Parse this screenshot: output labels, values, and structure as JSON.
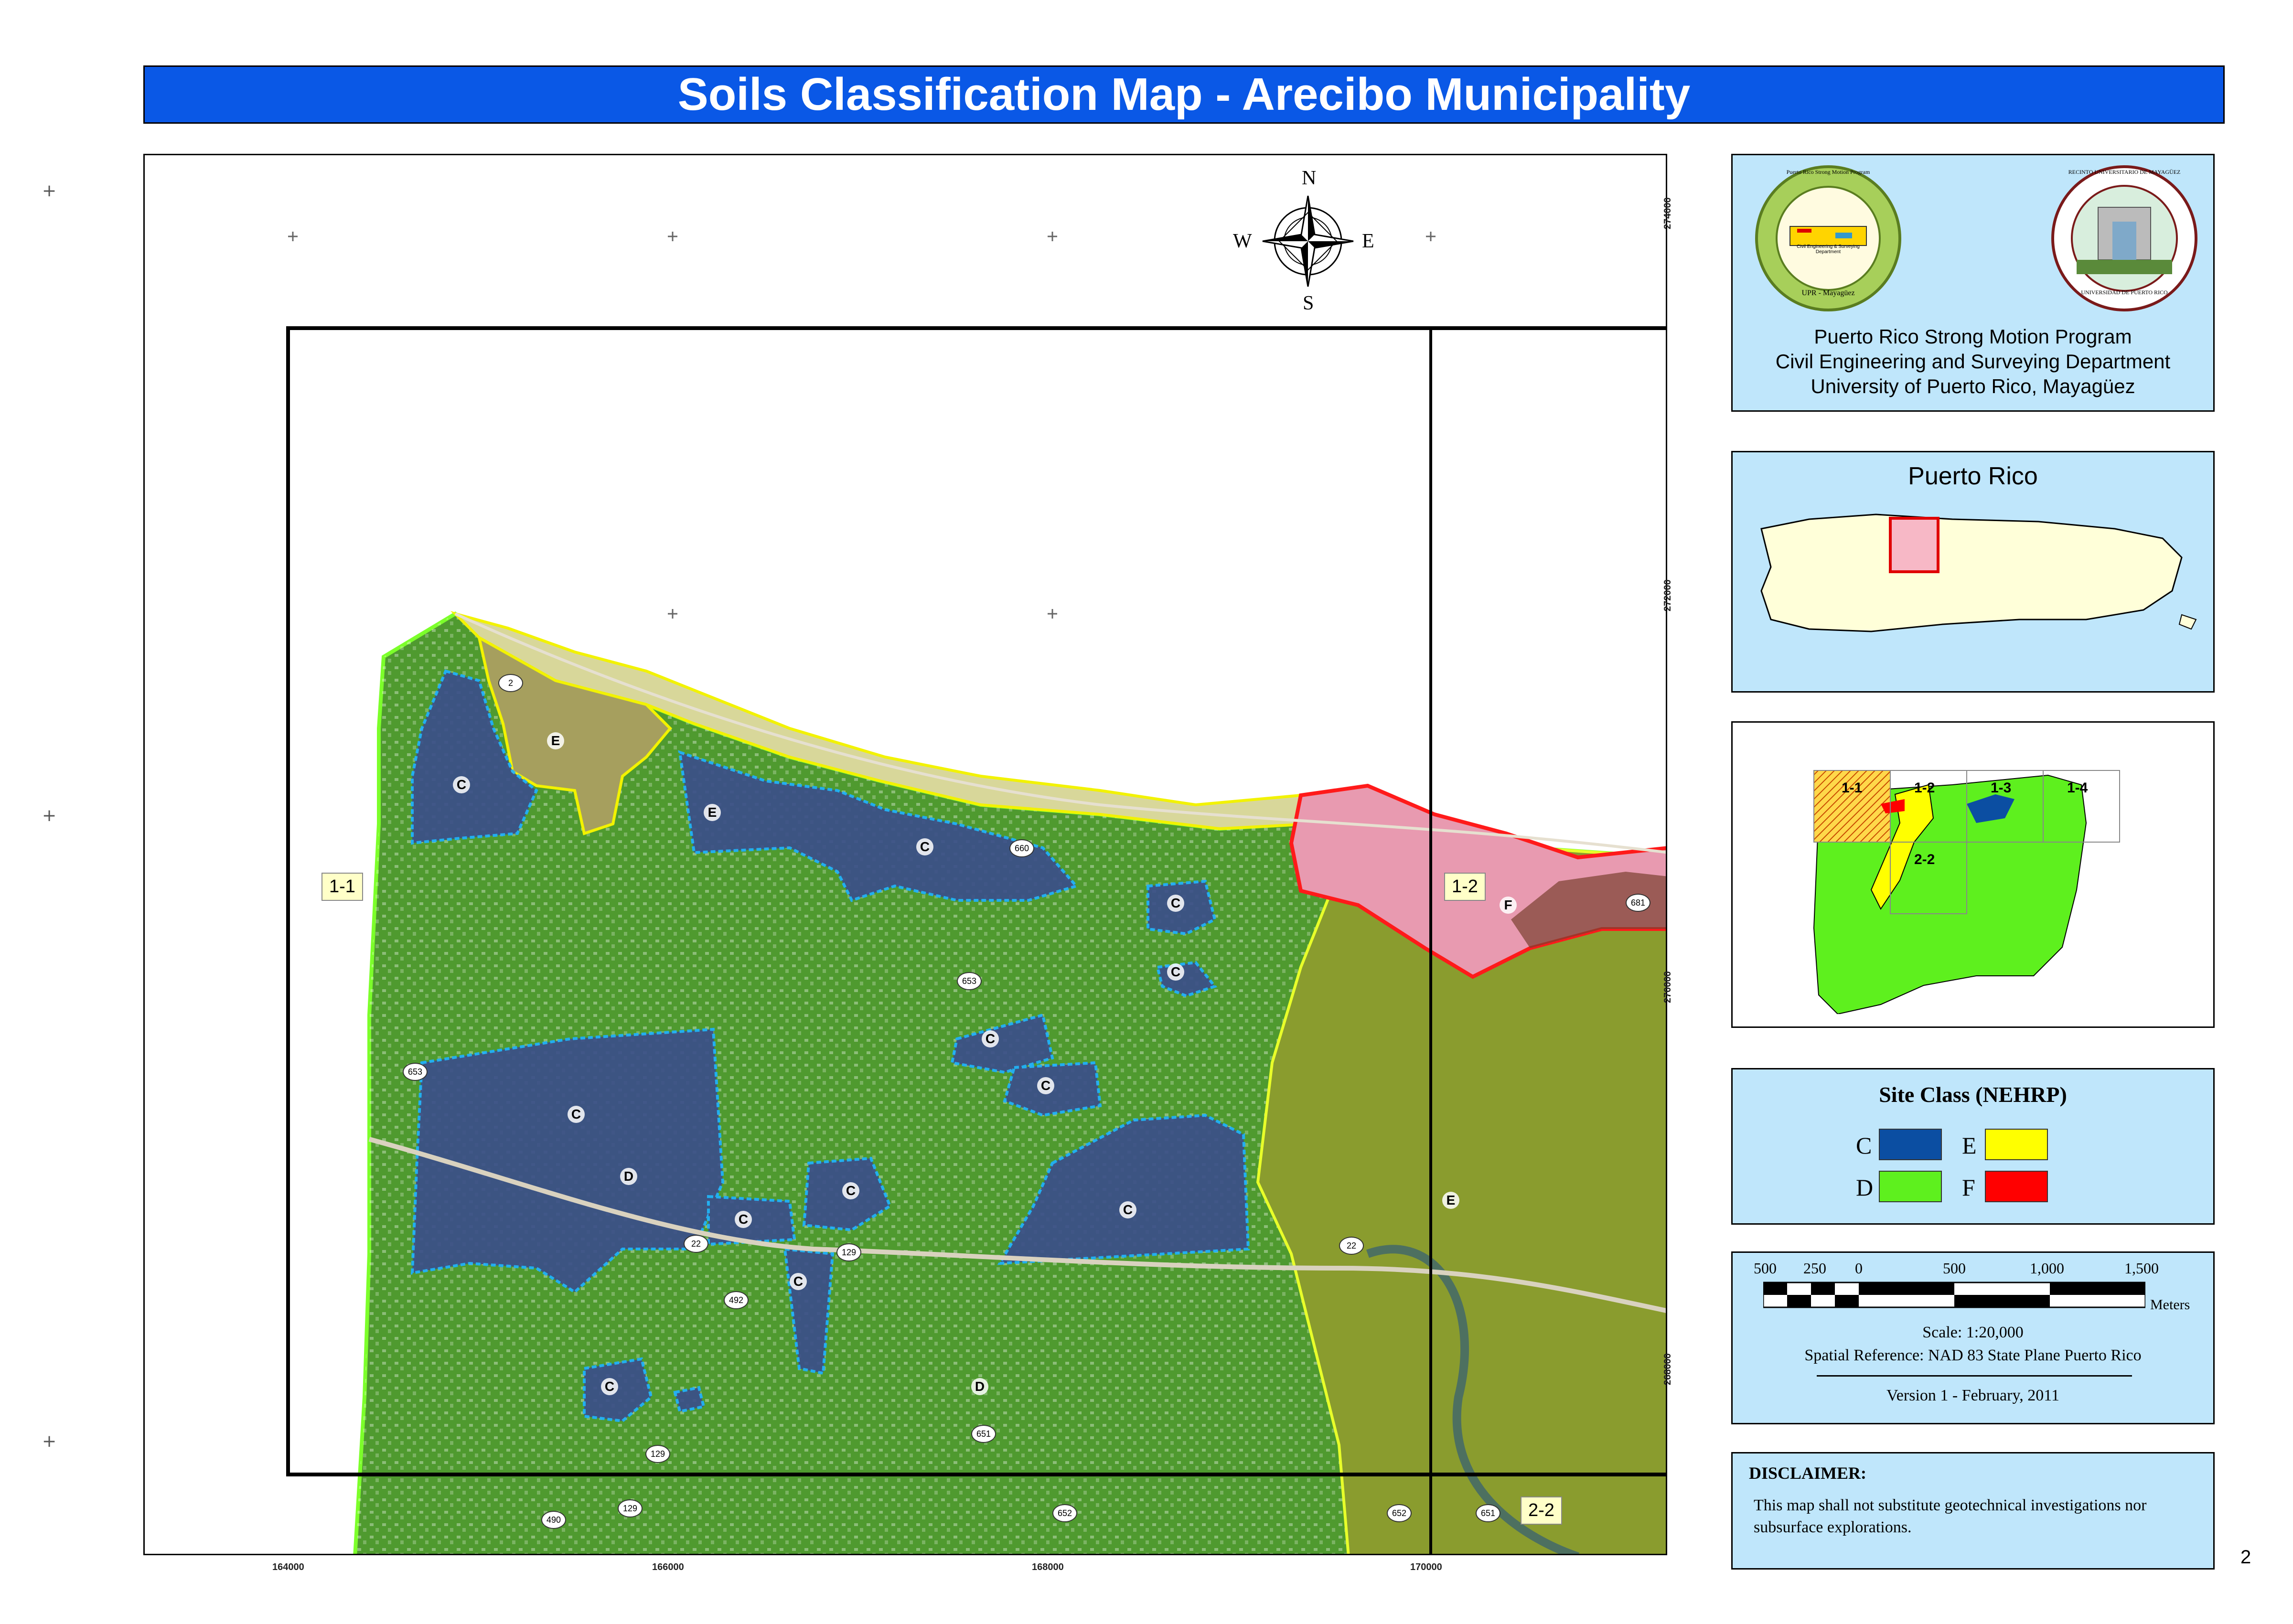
{
  "title": "Soils Classification Map - Arecibo Municipality",
  "page_number": "2",
  "compass": {
    "n": "N",
    "s": "S",
    "e": "E",
    "w": "W"
  },
  "map_sheets": {
    "s11": "1-1",
    "s12": "1-2",
    "s22": "2-2"
  },
  "zone_labels": {
    "c1": "C",
    "c2": "C",
    "c3": "C",
    "c4": "C",
    "c5": "C",
    "c6": "C",
    "c7": "C",
    "c8": "C",
    "c9": "C",
    "c10": "C",
    "c11": "C",
    "c12": "C",
    "c13": "C",
    "d1": "D",
    "d2": "D",
    "e1": "E",
    "e2": "E",
    "e3": "E",
    "f1": "F"
  },
  "road_numbers": {
    "r2": "2",
    "r660": "660",
    "r681": "681",
    "r653a": "653",
    "r653b": "653",
    "r22a": "22",
    "r22b": "22",
    "r129a": "129",
    "r129b": "129",
    "r129c": "129",
    "r492": "492",
    "r651": "651",
    "r490": "490",
    "r652": "652",
    "r652b": "652",
    "r651b": "651"
  },
  "x_ticks": [
    "164000",
    "166000",
    "168000",
    "170000"
  ],
  "y_ticks": [
    "274000",
    "272000",
    "270000",
    "268000"
  ],
  "org": {
    "logo_left_ring": "Puerto Rico Strong Motion Program",
    "logo_left_bottom": "UPR - Mayagüez",
    "logo_left_inner": "Civil Engineering & Surveying Department",
    "logo_right_ring": "RECINTO UNIVERSITARIO DE MAYAGÜEZ",
    "logo_right_bottom": "UNIVERSIDAD DE PUERTO RICO",
    "line1": "Puerto Rico Strong Motion Program",
    "line2": "Civil Engineering and Surveying Department",
    "line3": "University of Puerto Rico, Mayagüez"
  },
  "locator": {
    "title": "Puerto Rico"
  },
  "index_map": {
    "s11": "1-1",
    "s12": "1-2",
    "s13": "1-3",
    "s14": "1-4",
    "s22": "2-2"
  },
  "legend": {
    "title": "Site Class (NEHRP)",
    "items": [
      {
        "label": "C",
        "color": "#0b4ea2"
      },
      {
        "label": "E",
        "color": "#ffff00"
      },
      {
        "label": "D",
        "color": "#5ef01e"
      },
      {
        "label": "F",
        "color": "#ff0000"
      }
    ]
  },
  "scale": {
    "ticks": [
      "500",
      "250",
      "0",
      "500",
      "1,000",
      "1,500"
    ],
    "unit": "Meters",
    "ratio": "Scale:  1:20,000",
    "reference": "Spatial Reference: NAD 83 State Plane Puerto Rico",
    "version": "Version 1 - February, 2011"
  },
  "disclaimer": {
    "heading": "DISCLAIMER:",
    "text": "This  map shall not substitute  geotechnical investigations nor subsurface explorations."
  }
}
